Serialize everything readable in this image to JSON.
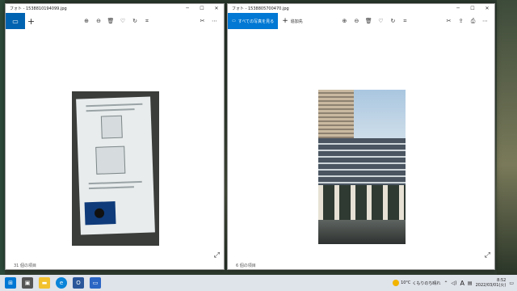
{
  "left_window": {
    "title": "フォト - 1538810194099.jpg",
    "status": "31 個の項目"
  },
  "right_window": {
    "title": "フォト - 1538805700470.jpg",
    "see_all_label": "すべての写真を見る",
    "add_to_label": "追加先",
    "status": "6 個の項目"
  },
  "taskbar": {
    "weather_temp": "10°C",
    "weather_text": "くもりのち晴れ",
    "ime_label": "A",
    "time": "8:52",
    "date": "2022/03/01(火)"
  },
  "icons": {
    "zoom_in": "⊕",
    "zoom_out": "⊖",
    "delete": "🗑",
    "favorite": "♡",
    "rotate": "↻",
    "crop": "⌗",
    "edit": "✂",
    "more": "⋯",
    "minimize": "─",
    "maximize": "☐",
    "close": "✕",
    "expand": "⤢",
    "share": "⇪",
    "print": "⎙"
  }
}
